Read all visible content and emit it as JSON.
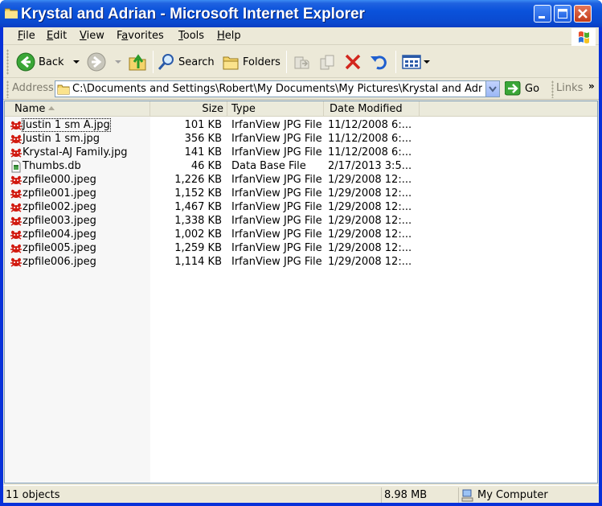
{
  "window": {
    "title": "Krystal and Adrian - Microsoft Internet Explorer"
  },
  "menu": {
    "items": [
      {
        "accel": "F",
        "rest": "ile"
      },
      {
        "accel": "E",
        "rest": "dit"
      },
      {
        "accel": "V",
        "rest": "iew"
      },
      {
        "accel": "",
        "pre": "F",
        "accel2": "a",
        "rest": "vorites"
      },
      {
        "accel": "T",
        "rest": "ools"
      },
      {
        "accel": "H",
        "rest": "elp"
      }
    ],
    "labels": [
      "File",
      "Edit",
      "View",
      "Favorites",
      "Tools",
      "Help"
    ]
  },
  "toolbar": {
    "back_label": "Back",
    "search_label": "Search",
    "folders_label": "Folders"
  },
  "addressbar": {
    "label": "Address",
    "value": "C:\\Documents and Settings\\Robert\\My Documents\\My Pictures\\Krystal and Adrian",
    "go_label": "Go",
    "links_label": "Links"
  },
  "columns": {
    "name": "Name",
    "size": "Size",
    "type": "Type",
    "date": "Date Modified"
  },
  "files": [
    {
      "name": "Justin 1 sm A.jpg",
      "size": "101 KB",
      "type": "IrfanView JPG File",
      "date": "11/12/2008 6:...",
      "icon": "irfanview-jpg-icon",
      "focused": true
    },
    {
      "name": "Justin 1 sm.jpg",
      "size": "356 KB",
      "type": "IrfanView JPG File",
      "date": "11/12/2008 6:...",
      "icon": "irfanview-jpg-icon"
    },
    {
      "name": "Krystal-AJ Family.jpg",
      "size": "141 KB",
      "type": "IrfanView JPG File",
      "date": "11/12/2008 6:...",
      "icon": "irfanview-jpg-icon"
    },
    {
      "name": "Thumbs.db",
      "size": "46 KB",
      "type": "Data Base File",
      "date": "2/17/2013 3:5...",
      "icon": "database-file-icon"
    },
    {
      "name": "zpfile000.jpeg",
      "size": "1,226 KB",
      "type": "IrfanView JPG File",
      "date": "1/29/2008 12:...",
      "icon": "irfanview-jpg-icon"
    },
    {
      "name": "zpfile001.jpeg",
      "size": "1,152 KB",
      "type": "IrfanView JPG File",
      "date": "1/29/2008 12:...",
      "icon": "irfanview-jpg-icon"
    },
    {
      "name": "zpfile002.jpeg",
      "size": "1,467 KB",
      "type": "IrfanView JPG File",
      "date": "1/29/2008 12:...",
      "icon": "irfanview-jpg-icon"
    },
    {
      "name": "zpfile003.jpeg",
      "size": "1,338 KB",
      "type": "IrfanView JPG File",
      "date": "1/29/2008 12:...",
      "icon": "irfanview-jpg-icon"
    },
    {
      "name": "zpfile004.jpeg",
      "size": "1,002 KB",
      "type": "IrfanView JPG File",
      "date": "1/29/2008 12:...",
      "icon": "irfanview-jpg-icon"
    },
    {
      "name": "zpfile005.jpeg",
      "size": "1,259 KB",
      "type": "IrfanView JPG File",
      "date": "1/29/2008 12:...",
      "icon": "irfanview-jpg-icon"
    },
    {
      "name": "zpfile006.jpeg",
      "size": "1,114 KB",
      "type": "IrfanView JPG File",
      "date": "1/29/2008 12:...",
      "icon": "irfanview-jpg-icon"
    }
  ],
  "status": {
    "objects": "11 objects",
    "size": "8.98 MB",
    "zone": "My Computer"
  },
  "colors": {
    "title_blue": "#0a4ad0",
    "face": "#ece9d8",
    "sort_column": "#f7f7f7"
  }
}
